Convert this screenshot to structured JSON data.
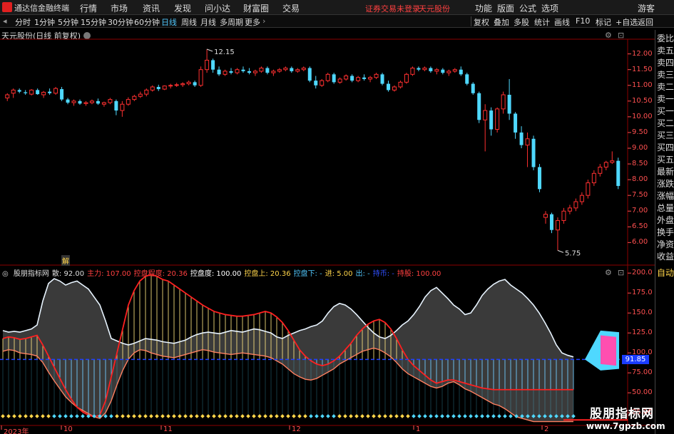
{
  "menubar": {
    "app_name": "通达信金融终端",
    "menus": [
      "行情",
      "市场",
      "资讯",
      "发现",
      "问小达",
      "财富圈",
      "交易"
    ],
    "notice": "证券交易未登录",
    "stock": "天元股份",
    "right": [
      "功能",
      "版面",
      "公式",
      "选项"
    ],
    "guest": "游客"
  },
  "periodbar": {
    "periods": [
      "分时",
      "1分钟",
      "5分钟",
      "15分钟",
      "30分钟",
      "60分钟",
      "日线",
      "周线",
      "月线",
      "多周期",
      "更多"
    ],
    "active": "日线",
    "tools": [
      "复权",
      "叠加",
      "多股",
      "统计",
      "画线",
      "F10",
      "标记",
      "+自选",
      "返回"
    ]
  },
  "main_header": {
    "title": "天元股份(日线 前复权)"
  },
  "sidebar": {
    "items": [
      "委比",
      "卖五",
      "卖四",
      "卖三",
      "卖二",
      "卖一",
      "买一",
      "买二",
      "买三",
      "买四",
      "买五",
      "最新",
      "涨跌",
      "涨幅",
      "总量",
      "外盘",
      "换手",
      "净资",
      "收益"
    ],
    "auto": "自动"
  },
  "price_axis": [
    "12.00",
    "11.50",
    "11.00",
    "10.50",
    "10.00",
    "9.50",
    "9.00",
    "8.50",
    "8.00",
    "7.50",
    "7.00",
    "6.50",
    "6.00"
  ],
  "price_annotations": {
    "high": "12.15",
    "low": "5.75"
  },
  "osc_axis": [
    "200.0",
    "175.0",
    "150.0",
    "125.0",
    "100.0",
    "75.00",
    "50.00",
    "25.00"
  ],
  "osc_current": "91.85",
  "osc_header": {
    "name": "股朋指标网",
    "items": [
      {
        "label": "散: 92.00",
        "color": "#dddddd"
      },
      {
        "label": "主力: 107.00",
        "color": "#ff4040"
      },
      {
        "label": "控盘程度: 20.36",
        "color": "#ff4040"
      },
      {
        "label": "控盘度: 100.00",
        "color": "#ffffff"
      },
      {
        "label": "控盘上: 20.36",
        "color": "#ffd54a"
      },
      {
        "label": "控盘下: -",
        "color": "#4fc3f7"
      },
      {
        "label": "进: 5.00",
        "color": "#ffd54a"
      },
      {
        "label": "出: -",
        "color": "#4fc3f7"
      },
      {
        "label": "持币: -",
        "color": "#3050ff"
      },
      {
        "label": "持股: 100.00",
        "color": "#ff4040"
      }
    ]
  },
  "marker": "解",
  "date_axis": [
    "2023年",
    "10",
    "11",
    "12",
    "1",
    "2"
  ],
  "watermark": {
    "line1": "股朋指标网",
    "line2": "www.7gpzb.com"
  },
  "colors": {
    "up": "#ff3030",
    "down": "#4fd8ff",
    "axis": "#ff5050",
    "grid": "#8b0000"
  },
  "chart_data": {
    "type": "candlestick",
    "price_ylim": [
      5.6,
      12.4
    ],
    "candles": [
      [
        10.6,
        10.75,
        10.5,
        10.7
      ],
      [
        10.75,
        10.9,
        10.6,
        10.85
      ],
      [
        10.85,
        10.9,
        10.75,
        10.8
      ],
      [
        10.78,
        10.85,
        10.7,
        10.75
      ],
      [
        10.72,
        10.88,
        10.68,
        10.85
      ],
      [
        10.85,
        10.9,
        10.7,
        10.72
      ],
      [
        10.7,
        10.82,
        10.6,
        10.78
      ],
      [
        10.8,
        10.9,
        10.7,
        10.75
      ],
      [
        10.75,
        10.95,
        10.7,
        10.9
      ],
      [
        10.88,
        10.95,
        10.5,
        10.55
      ],
      [
        10.55,
        10.6,
        10.4,
        10.45
      ],
      [
        10.45,
        10.55,
        10.35,
        10.5
      ],
      [
        10.5,
        10.55,
        10.38,
        10.42
      ],
      [
        10.42,
        10.5,
        10.35,
        10.45
      ],
      [
        10.45,
        10.55,
        10.4,
        10.5
      ],
      [
        10.5,
        10.58,
        10.38,
        10.42
      ],
      [
        10.4,
        10.48,
        10.32,
        10.45
      ],
      [
        10.45,
        10.6,
        10.4,
        10.55
      ],
      [
        10.5,
        10.55,
        10.05,
        10.2
      ],
      [
        10.2,
        10.5,
        10.0,
        10.4
      ],
      [
        10.4,
        10.62,
        10.35,
        10.55
      ],
      [
        10.55,
        10.7,
        10.5,
        10.65
      ],
      [
        10.65,
        10.8,
        10.6,
        10.72
      ],
      [
        10.72,
        10.9,
        10.65,
        10.85
      ],
      [
        10.85,
        11.0,
        10.8,
        10.95
      ],
      [
        10.95,
        11.02,
        10.82,
        10.88
      ],
      [
        10.88,
        11.0,
        10.85,
        10.98
      ],
      [
        10.98,
        11.05,
        10.9,
        11.0
      ],
      [
        11.0,
        11.08,
        10.95,
        11.02
      ],
      [
        11.02,
        11.1,
        10.95,
        11.05
      ],
      [
        11.05,
        11.15,
        11.0,
        11.1
      ],
      [
        11.1,
        11.15,
        10.95,
        11.0
      ],
      [
        11.0,
        11.6,
        10.95,
        11.5
      ],
      [
        11.5,
        12.15,
        11.4,
        11.8
      ],
      [
        11.8,
        11.85,
        11.4,
        11.5
      ],
      [
        11.5,
        11.6,
        11.3,
        11.35
      ],
      [
        11.35,
        11.5,
        11.3,
        11.45
      ],
      [
        11.45,
        11.55,
        11.35,
        11.4
      ],
      [
        11.4,
        11.55,
        11.35,
        11.5
      ],
      [
        11.5,
        11.6,
        11.4,
        11.45
      ],
      [
        11.45,
        11.55,
        11.35,
        11.4
      ],
      [
        11.4,
        11.5,
        11.3,
        11.45
      ],
      [
        11.45,
        11.6,
        11.4,
        11.55
      ],
      [
        11.55,
        11.6,
        11.35,
        11.4
      ],
      [
        11.4,
        11.5,
        11.3,
        11.45
      ],
      [
        11.45,
        11.55,
        11.4,
        11.5
      ],
      [
        11.5,
        11.6,
        11.45,
        11.55
      ],
      [
        11.55,
        11.6,
        11.4,
        11.45
      ],
      [
        11.45,
        11.55,
        11.4,
        11.5
      ],
      [
        11.5,
        11.6,
        11.45,
        11.55
      ],
      [
        11.55,
        11.6,
        11.1,
        11.15
      ],
      [
        11.15,
        11.3,
        10.9,
        11.0
      ],
      [
        11.0,
        11.2,
        10.95,
        11.15
      ],
      [
        11.15,
        11.4,
        11.1,
        11.35
      ],
      [
        11.35,
        11.4,
        11.05,
        11.1
      ],
      [
        11.1,
        11.25,
        11.05,
        11.2
      ],
      [
        11.2,
        11.35,
        11.15,
        11.3
      ],
      [
        11.3,
        11.35,
        11.1,
        11.15
      ],
      [
        11.15,
        11.3,
        11.1,
        11.25
      ],
      [
        11.25,
        11.35,
        11.15,
        11.2
      ],
      [
        11.2,
        11.3,
        11.1,
        11.25
      ],
      [
        11.25,
        11.4,
        11.2,
        11.35
      ],
      [
        11.35,
        11.4,
        11.0,
        11.05
      ],
      [
        11.05,
        11.15,
        10.8,
        10.85
      ],
      [
        10.85,
        11.0,
        10.8,
        10.95
      ],
      [
        10.95,
        11.15,
        10.9,
        11.1
      ],
      [
        11.1,
        11.4,
        11.05,
        11.35
      ],
      [
        11.35,
        11.6,
        11.3,
        11.55
      ],
      [
        11.55,
        11.6,
        11.45,
        11.5
      ],
      [
        11.5,
        11.6,
        11.45,
        11.55
      ],
      [
        11.55,
        11.6,
        11.4,
        11.45
      ],
      [
        11.45,
        11.55,
        11.35,
        11.5
      ],
      [
        11.5,
        11.55,
        11.35,
        11.4
      ],
      [
        11.4,
        11.5,
        11.3,
        11.45
      ],
      [
        11.45,
        11.55,
        11.4,
        11.5
      ],
      [
        11.5,
        11.6,
        11.3,
        11.35
      ],
      [
        11.35,
        11.4,
        11.0,
        11.05
      ],
      [
        11.05,
        11.1,
        10.7,
        10.75
      ],
      [
        10.75,
        10.8,
        9.8,
        9.9
      ],
      [
        9.9,
        10.4,
        8.9,
        10.2
      ],
      [
        10.2,
        10.3,
        9.4,
        9.6
      ],
      [
        9.6,
        10.3,
        9.5,
        10.25
      ],
      [
        10.25,
        10.8,
        10.1,
        10.7
      ],
      [
        10.7,
        11.2,
        9.9,
        10.1
      ],
      [
        10.1,
        10.15,
        9.3,
        9.5
      ],
      [
        9.5,
        9.7,
        9.0,
        9.1
      ],
      [
        9.1,
        9.5,
        8.4,
        9.3
      ],
      [
        9.3,
        9.4,
        8.3,
        8.4
      ],
      [
        8.4,
        8.5,
        7.6,
        7.7
      ],
      [
        6.8,
        7.0,
        6.6,
        6.9
      ],
      [
        6.9,
        6.95,
        6.3,
        6.4
      ],
      [
        6.4,
        6.8,
        5.75,
        6.7
      ],
      [
        6.7,
        7.1,
        6.6,
        7.0
      ],
      [
        7.0,
        7.2,
        6.9,
        7.1
      ],
      [
        7.1,
        7.4,
        7.0,
        7.3
      ],
      [
        7.3,
        7.6,
        7.2,
        7.5
      ],
      [
        7.5,
        8.0,
        7.4,
        7.9
      ],
      [
        7.9,
        8.3,
        7.8,
        8.2
      ],
      [
        8.2,
        8.5,
        8.1,
        8.4
      ],
      [
        8.4,
        8.6,
        8.3,
        8.55
      ],
      [
        8.55,
        8.9,
        8.5,
        8.6
      ],
      [
        8.6,
        8.7,
        7.7,
        7.8
      ]
    ],
    "osc_ylim": [
      10,
      210
    ],
    "white_line": [
      128,
      126,
      127,
      126,
      128,
      130,
      135,
      165,
      187,
      193,
      190,
      185,
      188,
      190,
      185,
      180,
      170,
      160,
      140,
      118,
      115,
      112,
      110,
      112,
      115,
      118,
      117,
      116,
      114,
      113,
      112,
      114,
      116,
      120,
      123,
      125,
      126,
      125,
      124,
      126,
      128,
      127,
      126,
      128,
      130,
      129,
      127,
      125,
      120,
      118,
      122,
      125,
      128,
      130,
      133,
      135,
      140,
      150,
      158,
      162,
      160,
      155,
      148,
      140,
      132,
      125,
      120,
      118,
      122,
      128,
      135,
      140,
      148,
      158,
      170,
      178,
      182,
      175,
      168,
      160,
      155,
      148,
      150,
      160,
      172,
      180,
      186,
      190,
      192,
      185,
      180,
      175,
      168,
      160,
      150,
      138,
      125,
      110,
      100,
      97,
      95
    ],
    "yellow_line": [
      102,
      104,
      103,
      100,
      99,
      98,
      96,
      88,
      76,
      65,
      55,
      45,
      38,
      32,
      28,
      24,
      20,
      18,
      25,
      40,
      60,
      78,
      92,
      100,
      104,
      103,
      100,
      98,
      96,
      95,
      94,
      96,
      98,
      100,
      102,
      104,
      103,
      101,
      100,
      99,
      98,
      99,
      100,
      99,
      98,
      97,
      96,
      94,
      90,
      86,
      80,
      74,
      70,
      67,
      66,
      68,
      72,
      76,
      80,
      86,
      90,
      94,
      98,
      102,
      104,
      106,
      104,
      100,
      95,
      88,
      80,
      74,
      70,
      66,
      62,
      58,
      56,
      58,
      62,
      64,
      60,
      55,
      52,
      48,
      44,
      40,
      36,
      34,
      30,
      25,
      20,
      18,
      16,
      14,
      14,
      14,
      14,
      14,
      14,
      14,
      14
    ],
    "red_line": [
      118,
      120,
      119,
      117,
      118,
      120,
      122,
      110,
      96,
      82,
      68,
      54,
      42,
      32,
      26,
      22,
      20,
      22,
      40,
      70,
      100,
      130,
      160,
      178,
      190,
      196,
      198,
      196,
      192,
      190,
      185,
      180,
      175,
      170,
      165,
      160,
      156,
      152,
      150,
      148,
      147,
      146,
      146,
      147,
      148,
      150,
      152,
      150,
      145,
      138,
      128,
      116,
      104,
      96,
      90,
      86,
      84,
      86,
      90,
      96,
      104,
      112,
      122,
      130,
      136,
      140,
      142,
      138,
      130,
      118,
      104,
      92,
      84,
      78,
      72,
      66,
      62,
      64,
      66,
      66,
      64,
      62,
      60,
      58,
      56,
      55,
      54,
      54,
      54,
      54,
      54,
      54,
      54,
      54,
      54,
      54,
      54,
      54,
      54,
      54,
      54
    ],
    "baseline": 91.85
  }
}
